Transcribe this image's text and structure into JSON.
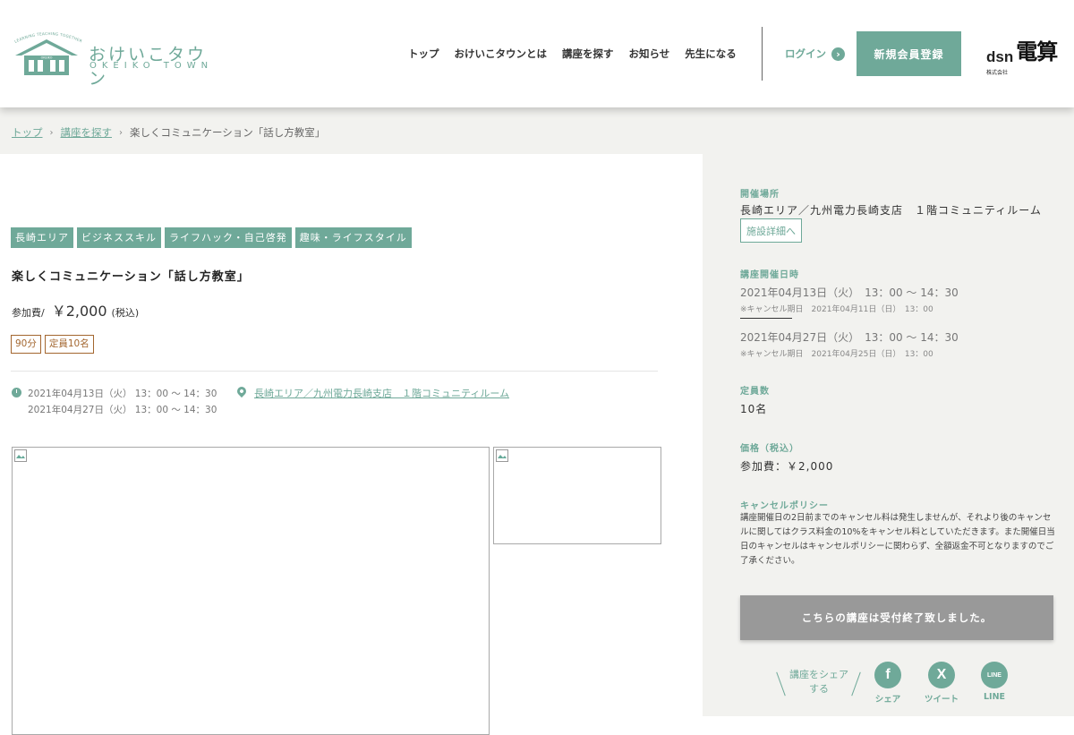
{
  "header": {
    "logo_main": "おけいこタウン",
    "logo_sub": "OKEIKO TOWN",
    "logo_arc": "LEARNING TEACHING TOGETHER",
    "logo_house": "OKEIKO",
    "nav": [
      "トップ",
      "おけいこタウンとは",
      "講座を探す",
      "お知らせ",
      "先生になる"
    ],
    "login": "ログイン",
    "register": "新規会員登録",
    "brand_dsn": "dsn",
    "brand_kabu": "株式会社",
    "brand_name": "電算"
  },
  "breadcrumb": {
    "items": [
      "トップ",
      "講座を探す"
    ],
    "current": "楽しくコミュニケーション「話し方教室」"
  },
  "course": {
    "tags": [
      "長崎エリア",
      "ビジネススキル",
      "ライフハック・自己啓発",
      "趣味・ライフスタイル"
    ],
    "title": "楽しくコミュニケーション「話し方教室」",
    "price_label": "参加費/",
    "price_value": "￥2,000",
    "price_tax": "(税込)",
    "chips": [
      "90分",
      "定員10名"
    ],
    "dates": [
      "2021年04月13日（火） 13：00 〜 14：30",
      "2021年04月27日（火） 13：00 〜 14：30"
    ],
    "venue": "長崎エリア／九州電力長崎支店　１階コミュニティルーム"
  },
  "sidebar": {
    "venue_label": "開催場所",
    "venue_value": "長崎エリア／九州電力長崎支店　１階コミュニティルーム",
    "facility_button": "施設詳細へ",
    "date_label": "講座開催日時",
    "sessions": [
      {
        "date": "2021年04月13日（火）　13：00 〜 14：30",
        "cancel": "※キャンセル期日　2021年04月11日（日）　13：00"
      },
      {
        "date": "2021年04月27日（火）　13：00 〜 14：30",
        "cancel": "※キャンセル期日　2021年04月25日（日）　13：00"
      }
    ],
    "capacity_label": "定員数",
    "capacity_value": "10名",
    "price_label": "価格（税込）",
    "price_value": "参加費：￥2,000",
    "policy_label": "キャンセルポリシー",
    "policy_text": "講座開催日の2日前までのキャンセル料は発生しませんが、それより後のキャンセルに関してはクラス料金の10%をキャンセル料としていただきます。また開催日当日のキャンセルはキャンセルポリシーに関わらず、全額返金不可となりますのでご了承ください。",
    "closed_button": "こちらの講座は受付終了致しました。",
    "share_text": "講座をシェアする",
    "share_buttons": [
      {
        "label": "シェア",
        "icon": "facebook-icon",
        "glyph": "f"
      },
      {
        "label": "ツイート",
        "icon": "x-icon",
        "glyph": "X"
      },
      {
        "label": "LINE",
        "icon": "line-icon",
        "glyph": "LINE"
      }
    ]
  },
  "colors": {
    "accent": "#6fa999",
    "chip": "#a3662f",
    "closed": "#999999",
    "panel": "#f2f2ef"
  }
}
